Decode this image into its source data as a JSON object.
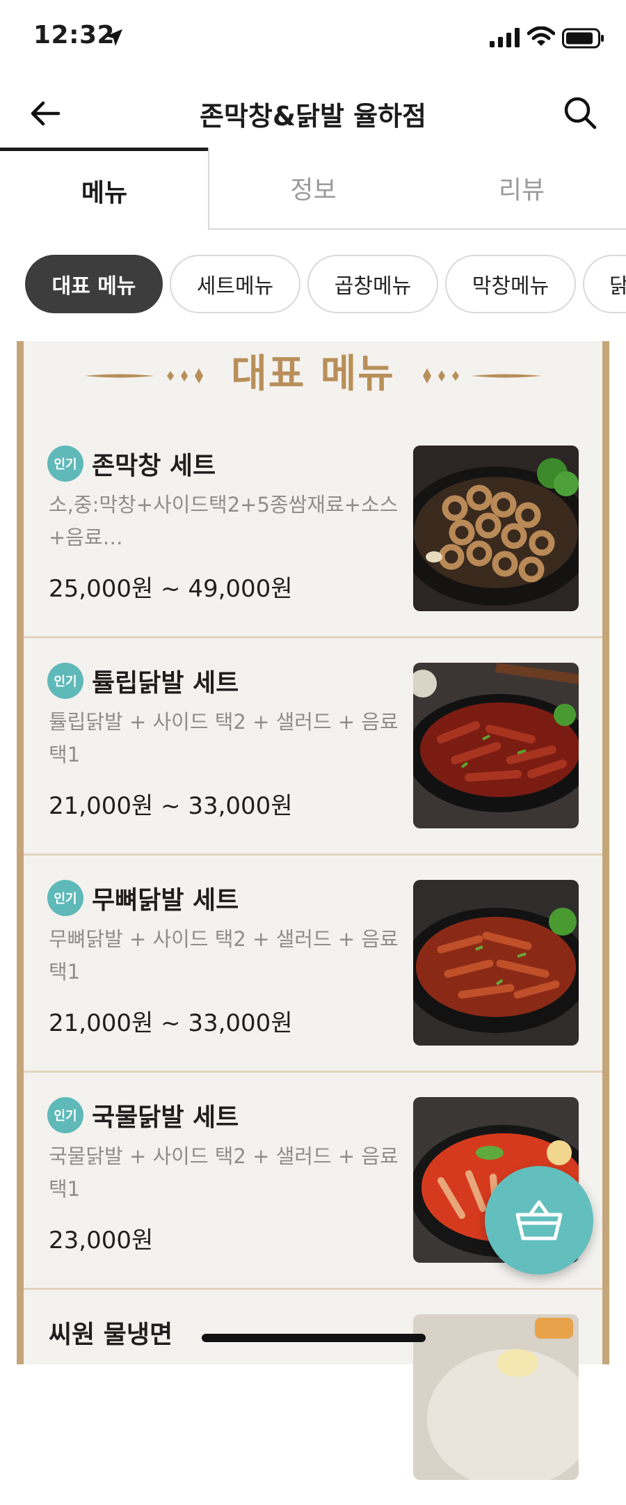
{
  "status_bar": {
    "time": "12:32"
  },
  "header": {
    "title": "존막창&닭발 율하점"
  },
  "tabs": [
    {
      "label": "메뉴",
      "active": true
    },
    {
      "label": "정보",
      "active": false
    },
    {
      "label": "리뷰",
      "active": false
    }
  ],
  "chips": [
    {
      "label": "대표 메뉴",
      "active": true
    },
    {
      "label": "세트메뉴",
      "active": false
    },
    {
      "label": "곱창메뉴",
      "active": false
    },
    {
      "label": "막창메뉴",
      "active": false
    },
    {
      "label": "닭발",
      "active": false
    }
  ],
  "section": {
    "title": "대표 메뉴"
  },
  "items": [
    {
      "badge": "인기",
      "name": "존막창 세트",
      "description": "소,중:막창+사이드택2+5종쌈재료+소스+음료…",
      "price": "25,000원 ~ 49,000원",
      "image": "grilled-makchang-photo"
    },
    {
      "badge": "인기",
      "name": "튤립닭발 세트",
      "description": "튤립닭발 + 사이드 택2 + 샐러드 + 음료 택1",
      "price": "21,000원 ~ 33,000원",
      "image": "tulip-chicken-feet-photo"
    },
    {
      "badge": "인기",
      "name": "무뼈닭발 세트",
      "description": "무뼈닭발 + 사이드 택2 + 샐러드 + 음료 택1",
      "price": "21,000원 ~ 33,000원",
      "image": "boneless-chicken-feet-photo"
    },
    {
      "badge": "인기",
      "name": "국물닭발 세트",
      "description": "국물닭발 + 사이드 택2 + 샐러드 + 음료 택1",
      "price": "23,000원",
      "image": "soup-chicken-feet-photo"
    },
    {
      "badge": "",
      "name": "씨원 물냉면",
      "description": "",
      "price": "",
      "image": "cold-noodle-photo"
    }
  ],
  "colors": {
    "accent_teal": "#62bfbd",
    "frame_gold": "#c5a57a",
    "chip_active": "#3d3d3d"
  }
}
